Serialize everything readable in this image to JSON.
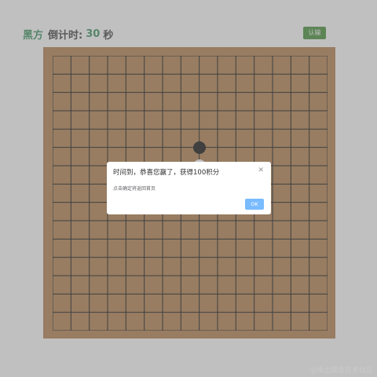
{
  "header": {
    "player": "黑方",
    "timer_label": "倒计时:",
    "timer_value": "30",
    "timer_unit": "秒"
  },
  "toolbar": {
    "resign_label": "认输"
  },
  "board": {
    "size": 15,
    "stones": [
      {
        "color": "black",
        "col": 8,
        "row": 5
      },
      {
        "color": "white",
        "col": 8,
        "row": 6
      }
    ]
  },
  "dialog": {
    "title": "时间到，恭喜您赢了，获得100积分",
    "message": "点击确定将返回首页",
    "close_icon": "close-icon",
    "ok_label": "OK"
  },
  "watermark": "@稀土掘金技术社区"
}
